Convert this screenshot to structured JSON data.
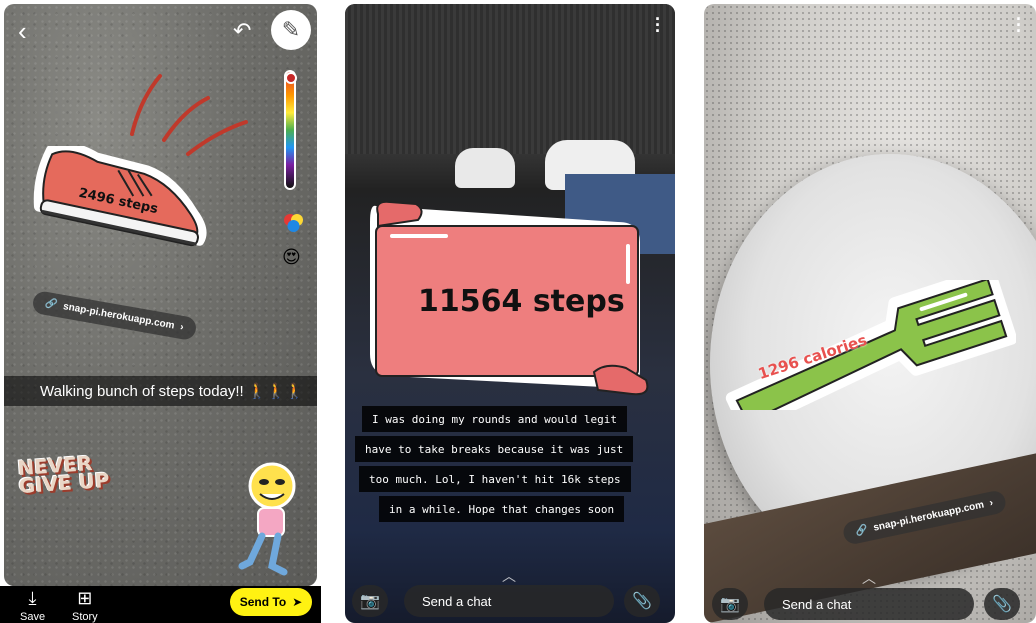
{
  "panel1": {
    "caption": "Walking bunch of steps today!! 🚶🚶🚶",
    "shoe_sticker": "2496 steps",
    "url_pill": "snap-pi.herokuapp.com",
    "never_give_up": [
      "NEVER",
      "GIVE UP"
    ],
    "footer": {
      "save_label": "Save",
      "story_label": "Story",
      "send_to_label": "Send To"
    }
  },
  "panel2": {
    "banner_sticker": "11564 steps",
    "caption_lines": [
      "I was doing my rounds and would legit",
      "have to take breaks because it was just",
      "too much. Lol, I haven't hit 16k steps",
      "in a while. Hope that changes soon"
    ],
    "chat_placeholder": "Send a chat"
  },
  "panel3": {
    "fork_sticker": "1296 calories",
    "url_pill": "snap-pi.herokuapp.com",
    "chat_placeholder": "Send a chat"
  },
  "colors": {
    "send_to_bg": "#fff212",
    "shoe_red": "#e56a5c",
    "banner_red": "#ee7e7e",
    "fork_green": "#8bc34a"
  },
  "icons": [
    "back-arrow-icon",
    "undo-icon",
    "pencil-icon",
    "color-palette-icon",
    "emoji-icon",
    "download-icon",
    "add-story-icon",
    "send-arrow-icon",
    "camera-icon",
    "paperclip-icon",
    "more-vertical-icon",
    "chevron-up-icon",
    "link-icon"
  ]
}
